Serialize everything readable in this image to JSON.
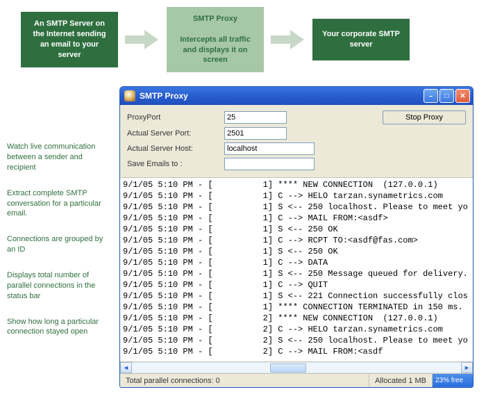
{
  "flow": {
    "box1": "An SMTP Server on the Internet sending an email to your server",
    "box2": "SMTP Proxy\n\nIntercepts all traffic and displays it on screen",
    "box3": "Your corporate SMTP server"
  },
  "notes": [
    "Watch live communication between a sender and recipient",
    "Extract complete SMTP conversation for a particular email.",
    "Connections are grouped by an ID",
    "Displays total number of parallel connections in the status bar",
    "Show how long a particular connection stayed open"
  ],
  "window": {
    "title": "SMTP Proxy",
    "form": {
      "proxyPort": {
        "label": "ProxyPort",
        "value": "25"
      },
      "actualServerPort": {
        "label": "Actual Server Port:",
        "value": "2501"
      },
      "actualServerHost": {
        "label": "Actual Server Host:",
        "value": "localhost"
      },
      "saveEmailsTo": {
        "label": "Save Emails to :",
        "value": ""
      },
      "stopButton": "Stop Proxy"
    },
    "log": [
      "9/1/05 5:10 PM - [          1] **** NEW CONNECTION  (127.0.0.1)",
      "9/1/05 5:10 PM - [          1] C --> HELO tarzan.synametrics.com",
      "9/1/05 5:10 PM - [          1] S <-- 250 localhost. Please to meet yo",
      "9/1/05 5:10 PM - [          1] C --> MAIL FROM:<asdf>",
      "9/1/05 5:10 PM - [          1] S <-- 250 OK",
      "9/1/05 5:10 PM - [          1] C --> RCPT TO:<asdf@fas.com>",
      "9/1/05 5:10 PM - [          1] S <-- 250 OK",
      "9/1/05 5:10 PM - [          1] C --> DATA",
      "9/1/05 5:10 PM - [          1] S <-- 250 Message queued for delivery.",
      "9/1/05 5:10 PM - [          1] C --> QUIT",
      "9/1/05 5:10 PM - [          1] S <-- 221 Connection successfully clos",
      "9/1/05 5:10 PM - [          1] **** CONNECTION TERMINATED in 150 ms.",
      "9/1/05 5:10 PM - [          2] **** NEW CONNECTION  (127.0.0.1)",
      "9/1/05 5:10 PM - [          2] C --> HELO tarzan.synametrics.com",
      "9/1/05 5:10 PM - [          2] S <-- 250 localhost. Please to meet yo",
      "9/1/05 5:10 PM - [          2] C --> MAIL FROM:<asdf"
    ],
    "status": {
      "connections": "Total parallel connections: 0",
      "allocated": "Allocated 1 MB",
      "free": "23% free"
    }
  }
}
